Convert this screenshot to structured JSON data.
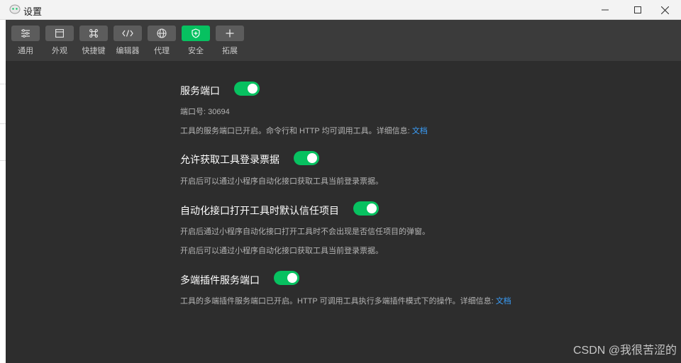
{
  "window": {
    "title": "设置",
    "controls": [
      "minimize",
      "maximize",
      "close"
    ]
  },
  "toolbar": {
    "items": [
      {
        "label": "通用",
        "icon": "general-icon",
        "active": false
      },
      {
        "label": "外观",
        "icon": "appearance-icon",
        "active": false
      },
      {
        "label": "快捷键",
        "icon": "shortcut-icon",
        "active": false
      },
      {
        "label": "编辑器",
        "icon": "editor-icon",
        "active": false
      },
      {
        "label": "代理",
        "icon": "globe-icon",
        "active": false
      },
      {
        "label": "安全",
        "icon": "shield-icon",
        "active": true
      },
      {
        "label": "拓展",
        "icon": "plus-icon",
        "active": false
      }
    ]
  },
  "settings": {
    "service_port": {
      "title": "服务端口",
      "enabled": true,
      "port_label": "端口号: 30694",
      "desc_text": "工具的服务端口已开启。命令行和 HTTP 均可调用工具。详细信息: ",
      "desc_link": "文档"
    },
    "login_ticket": {
      "title": "允许获取工具登录票据",
      "enabled": true,
      "desc": "开启后可以通过小程序自动化接口获取工具当前登录票据。"
    },
    "trust_project": {
      "title": "自动化接口打开工具时默认信任项目",
      "enabled": true,
      "desc1": "开启后通过小程序自动化接口打开工具时不会出现是否信任项目的弹窗。",
      "desc2": "开启后可以通过小程序自动化接口获取工具当前登录票据。"
    },
    "multi_plugin_port": {
      "title": "多端插件服务端口",
      "enabled": true,
      "desc_text": "工具的多端插件服务端口已开启。HTTP 可调用工具执行多端插件模式下的操作。详细信息: ",
      "desc_link": "文档"
    }
  },
  "watermark": "CSDN @我很苦涩的",
  "colors": {
    "accent": "#07c160",
    "link": "#3aa1ff",
    "background": "#2d2d2d",
    "toolbar": "#3b3b3b"
  }
}
